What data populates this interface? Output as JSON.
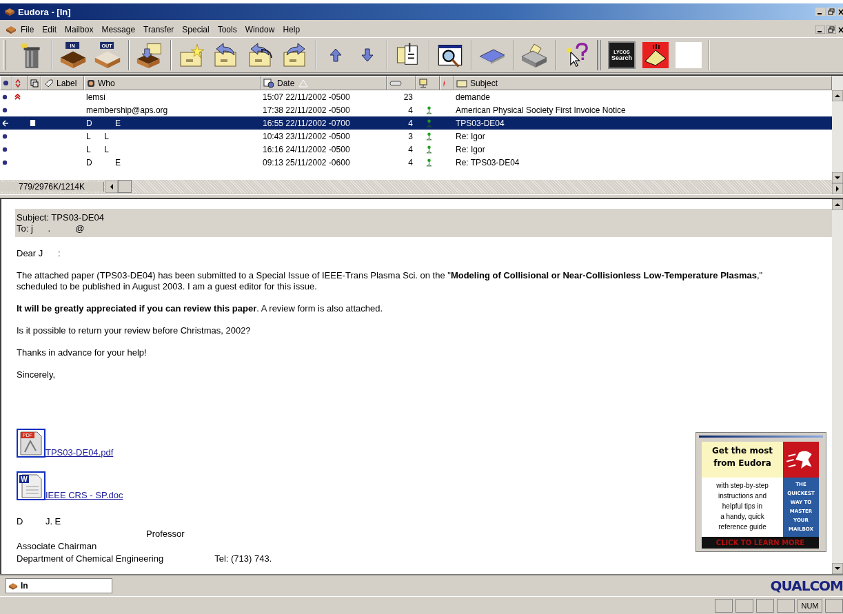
{
  "window": {
    "title": "Eudora - [In]"
  },
  "menu": [
    "File",
    "Edit",
    "Mailbox",
    "Message",
    "Transfer",
    "Special",
    "Tools",
    "Window",
    "Help"
  ],
  "toolbar": [
    [
      {
        "kind": "trash"
      }
    ],
    [
      {
        "kind": "inbox",
        "label": "IN"
      },
      {
        "kind": "outbox",
        "label": "OUT"
      }
    ],
    [
      {
        "kind": "check-mail"
      }
    ],
    [
      {
        "kind": "new-message"
      },
      {
        "kind": "reply"
      },
      {
        "kind": "reply-all"
      },
      {
        "kind": "forward"
      }
    ],
    [
      {
        "kind": "up"
      },
      {
        "kind": "down"
      }
    ],
    [
      {
        "kind": "attach"
      }
    ],
    [
      {
        "kind": "find"
      }
    ],
    [
      {
        "kind": "address-book"
      }
    ],
    [
      {
        "kind": "print"
      }
    ],
    [
      {
        "kind": "help"
      }
    ],
    [
      {
        "kind": "lycos",
        "label": "LYCOS",
        "caption": "Search"
      },
      {
        "kind": "ad"
      },
      {
        "kind": "blank"
      }
    ]
  ],
  "columns": [
    {
      "kind": "status"
    },
    {
      "kind": "priority"
    },
    {
      "kind": "attachment"
    },
    {
      "kind": "label",
      "label": "Label"
    },
    {
      "kind": "who",
      "label": "Who"
    },
    {
      "kind": "date",
      "label": "Date"
    },
    {
      "kind": "size"
    },
    {
      "kind": "server"
    },
    {
      "kind": "mood"
    },
    {
      "kind": "subject",
      "label": "Subject"
    }
  ],
  "rows": [
    {
      "replied": false,
      "high_priority": true,
      "attachment": false,
      "who": "lemsi",
      "date": "15:07 22/11/2002 -0500",
      "size": "23",
      "server": false,
      "subject": "demande",
      "selected": false
    },
    {
      "replied": false,
      "high_priority": false,
      "attachment": false,
      "who": "membership@aps.org",
      "date": "17:38 22/11/2002 -0500",
      "size": "4",
      "server": true,
      "subject": "American Physical Society First Invoice Notice",
      "selected": false
    },
    {
      "replied": true,
      "high_priority": false,
      "attachment": true,
      "who": "D          E",
      "date": "16:55 22/11/2002 -0700",
      "size": "4",
      "server": true,
      "subject": "TPS03-DE04",
      "selected": true
    },
    {
      "replied": false,
      "high_priority": false,
      "attachment": false,
      "who": "L      L",
      "date": "10:43 23/11/2002 -0500",
      "size": "3",
      "server": true,
      "subject": "Re: Igor",
      "selected": false
    },
    {
      "replied": false,
      "high_priority": false,
      "attachment": false,
      "who": "L      L",
      "date": "16:16 24/11/2002 -0500",
      "size": "4",
      "server": true,
      "subject": "Re: Igor",
      "selected": false
    },
    {
      "replied": false,
      "high_priority": false,
      "attachment": false,
      "who": "D          E",
      "date": "09:13 25/11/2002 -0600",
      "size": "4",
      "server": true,
      "subject": "Re: TPS03-DE04",
      "selected": false
    }
  ],
  "counter": "779/2976K/1214K",
  "message": {
    "header": [
      "Subject: TPS03-DE04",
      "To: j      .          @"
    ],
    "greeting": "Dear J      :",
    "paragraphs": [
      "The attached paper (TPS03-DE04) has been submitted to a Special Issue of IEEE-Trans Plasma Sci. on the \"**Modeling of Collisional or Near-Collisionless Low-Temperature Plasmas**,\" scheduled to be published in August 2003. I am a guest editor for this issue.",
      "**It will be greatly appreciated if you can review this paper**. A review form is also attached.",
      "Is it possible to return your review before Christmas, 2002?",
      "Thanks in advance for your help!",
      "Sincerely,"
    ],
    "attachments": [
      {
        "kind": "pdf",
        "badge": "PDF",
        "name": "TPS03-DE04.pdf"
      },
      {
        "kind": "word",
        "badge": "W",
        "name": "IEEE CRS - SP.doc"
      }
    ],
    "signature": {
      "name": "D         J. E",
      "title": "Professor",
      "role": "Associate Chairman",
      "department": "Department of Chemical Engineering",
      "phone": "Tel: (713) 743."
    }
  },
  "ad": {
    "headline": "Get the most from Eudora",
    "body": [
      "with step-by-step",
      "instructions and",
      "helpful tips in",
      "a handy, quick",
      "reference guide"
    ],
    "side": [
      "THE",
      "QUICKEST",
      "WAY TO",
      "MASTER",
      "YOUR",
      "MAILBOX"
    ],
    "cta": "CLICK TO LEARN MORE"
  },
  "mailbox": "In",
  "brand": "QUALCOM",
  "status_bar": {
    "indicator": "NUM"
  }
}
